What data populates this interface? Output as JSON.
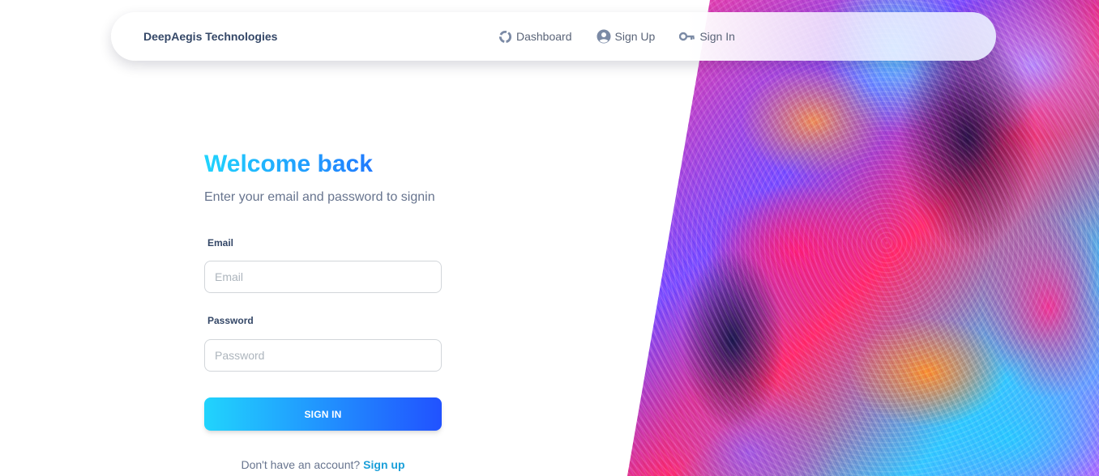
{
  "navbar": {
    "brand": "DeepAegis Technologies",
    "links": [
      {
        "label": "Dashboard",
        "icon": "donut-chart-icon"
      },
      {
        "label": "Sign Up",
        "icon": "user-circle-icon"
      },
      {
        "label": "Sign In",
        "icon": "key-icon"
      }
    ]
  },
  "login": {
    "title": "Welcome back",
    "subtitle": "Enter your email and password to signin",
    "email_label": "Email",
    "email_placeholder": "Email",
    "email_value": "",
    "password_label": "Password",
    "password_placeholder": "Password",
    "password_value": "",
    "submit_label": "SIGN IN",
    "footer_text": "Don't have an account?",
    "footer_link": "Sign up"
  },
  "colors": {
    "accent_start": "#21d4fd",
    "accent_end": "#2152ff",
    "heading_text": "#344767",
    "muted_text": "#67748e",
    "link": "#1a9fd9"
  }
}
